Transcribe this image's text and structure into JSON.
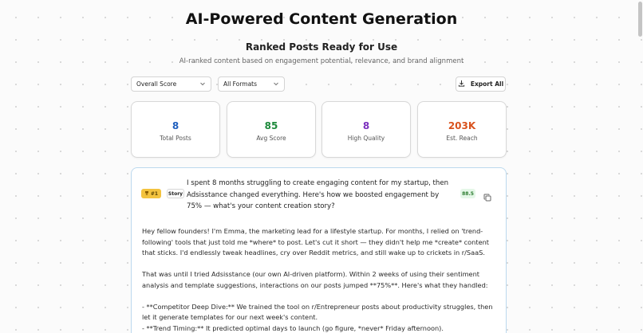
{
  "header": {
    "title": "AI-Powered Content Generation",
    "section_title": "Ranked Posts Ready for Use",
    "section_subtitle": "AI-ranked content based on engagement potential, relevance, and brand alignment"
  },
  "filters": {
    "sort_value": "Overall Score",
    "format_value": "All Formats",
    "export_label": "Export All"
  },
  "stats": [
    {
      "value": "8",
      "label": "Total Posts",
      "color": "#1f5fbf"
    },
    {
      "value": "85",
      "label": "Avg Score",
      "color": "#1e8a3c"
    },
    {
      "value": "8",
      "label": "High Quality",
      "color": "#7b2fbe"
    },
    {
      "value": "203K",
      "label": "Est. Reach",
      "color": "#d9531e"
    }
  ],
  "post": {
    "rank": "#1",
    "type": "Story",
    "title": "I spent 8 months struggling to create engaging content for my startup, then Adsisstance changed everything. Here's how we boosted engagement by 75% — what's your content creation story?",
    "score": "88.5",
    "body": [
      "Hey fellow founders! I'm Emma, the marketing lead for a lifestyle startup. For months, I relied on 'trend-following' tools that just told me *where* to post. Let's cut it short — they didn't help me *create* content that sticks. I'd endlessly tweak headlines, cry over Reddit metrics, and still wake up to crickets in r/SaaS.",
      "",
      "That was until I tried Adsisstance (our own AI-driven platform). Within 2 weeks of using their sentiment analysis and template suggestions, interactions on our posts jumped **75%**. Here's what they handled:",
      "",
      "- **Competitor Deep Dive:** We trained the tool on r/Entrepreneur posts about productivity struggles, then let it generate templates for our next week's content.",
      "- **Trend Timing:** It predicted optimal days to launch (go figure, *never* Friday afternoon)."
    ]
  }
}
